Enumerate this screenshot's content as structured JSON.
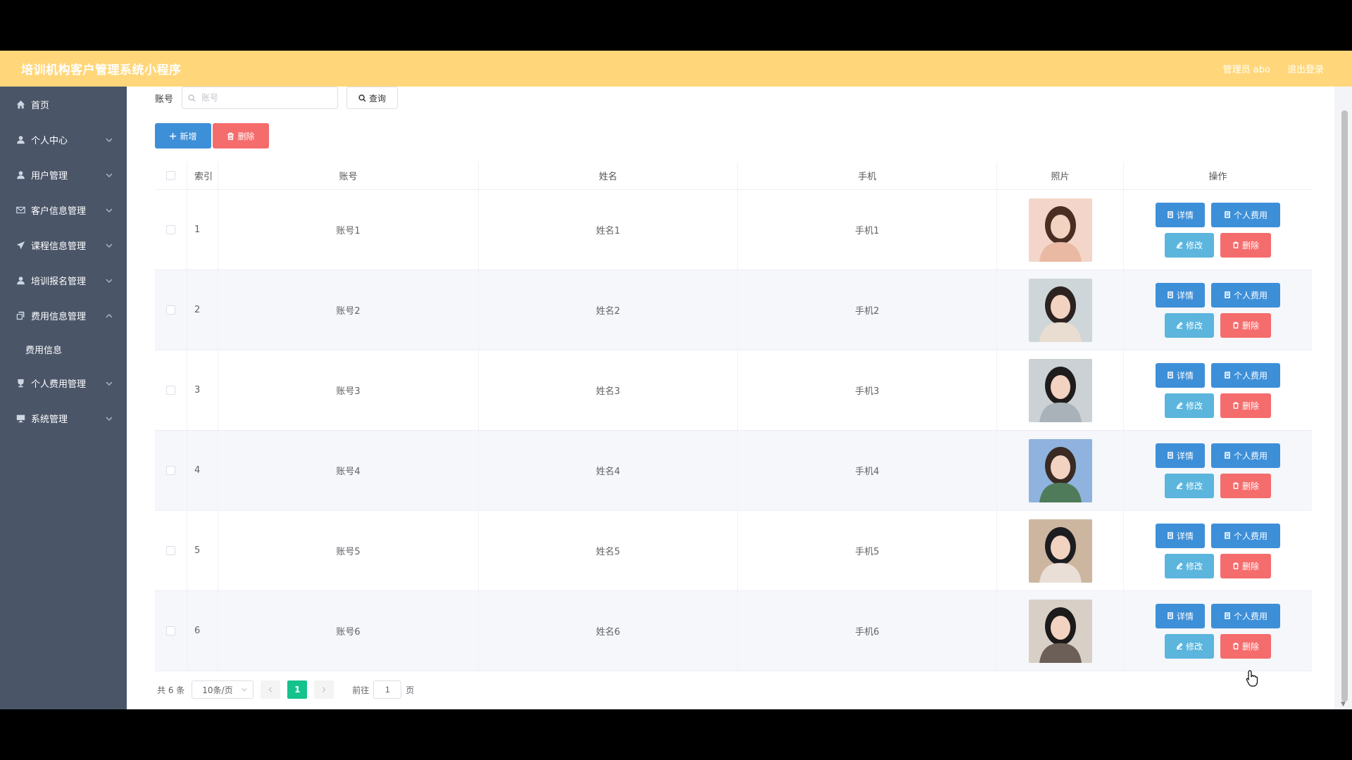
{
  "header": {
    "title": "培训机构客户管理系统小程序",
    "admin": "管理员 abo",
    "logout": "退出登录"
  },
  "sidebar": {
    "items": [
      {
        "label": "首页",
        "icon": "home-icon",
        "chevron": ""
      },
      {
        "label": "个人中心",
        "icon": "user-icon",
        "chevron": "down"
      },
      {
        "label": "用户管理",
        "icon": "user-icon",
        "chevron": "down"
      },
      {
        "label": "客户信息管理",
        "icon": "mail-icon",
        "chevron": "down"
      },
      {
        "label": "课程信息管理",
        "icon": "send-icon",
        "chevron": "down"
      },
      {
        "label": "培训报名管理",
        "icon": "user-icon",
        "chevron": "down"
      },
      {
        "label": "费用信息管理",
        "icon": "copy-icon",
        "chevron": "up"
      },
      {
        "label": "个人费用管理",
        "icon": "trophy-icon",
        "chevron": "down"
      },
      {
        "label": "系统管理",
        "icon": "monitor-icon",
        "chevron": "down"
      }
    ],
    "sub_item": "费用信息"
  },
  "search": {
    "label": "账号",
    "placeholder": "账号",
    "query_label": "查询"
  },
  "actions": {
    "add_label": "新增",
    "delete_label": "删除"
  },
  "table": {
    "headers": {
      "index": "索引",
      "account": "账号",
      "name": "姓名",
      "phone": "手机",
      "photo": "照片",
      "ops": "操作"
    },
    "rows": [
      {
        "index": "1",
        "account": "账号1",
        "name": "姓名1",
        "phone": "手机1"
      },
      {
        "index": "2",
        "account": "账号2",
        "name": "姓名2",
        "phone": "手机2"
      },
      {
        "index": "3",
        "account": "账号3",
        "name": "姓名3",
        "phone": "手机3"
      },
      {
        "index": "4",
        "account": "账号4",
        "name": "姓名4",
        "phone": "手机4"
      },
      {
        "index": "5",
        "account": "账号5",
        "name": "姓名5",
        "phone": "手机5"
      },
      {
        "index": "6",
        "account": "账号6",
        "name": "姓名6",
        "phone": "手机6"
      }
    ],
    "op_labels": {
      "detail": "详情",
      "fee": "个人费用",
      "edit": "修改",
      "delete": "删除"
    }
  },
  "pagination": {
    "total": "共 6 条",
    "page_size": "10条/页",
    "current_page": "1",
    "goto_prefix": "前往",
    "goto_value": "1",
    "goto_suffix": "页"
  },
  "colors": {
    "header_bg": "#ffd77a",
    "sidebar_bg": "#4a5568",
    "primary": "#3d8fd8",
    "danger": "#f56c6c",
    "edit": "#5bb5dd",
    "page_active": "#16c28c"
  }
}
